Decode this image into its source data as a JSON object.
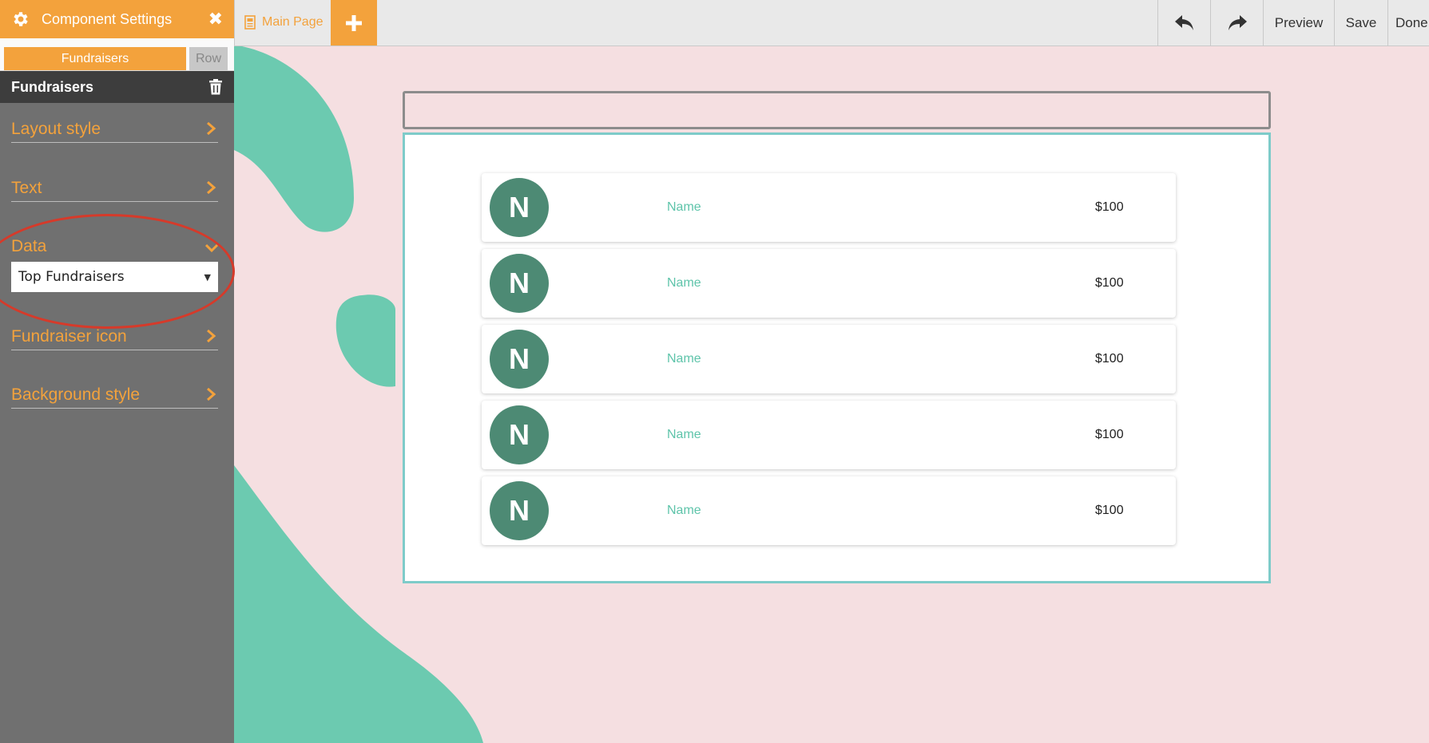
{
  "sidebar": {
    "header_title": "Component Settings",
    "tabs": [
      {
        "label": "Fundraisers",
        "active": true
      },
      {
        "label": "Row",
        "active": false
      }
    ],
    "section_title": "Fundraisers",
    "items": [
      {
        "label": "Layout style"
      },
      {
        "label": "Text"
      },
      {
        "label": "Data"
      },
      {
        "label": "Fundraiser icon"
      },
      {
        "label": "Background style"
      }
    ],
    "data_select_value": "Top Fundraisers"
  },
  "toolbar": {
    "page_tab": "Main Page",
    "preview": "Preview",
    "save": "Save",
    "done": "Done"
  },
  "fundraisers": [
    {
      "initial": "N",
      "name": "Name",
      "amount": "$100"
    },
    {
      "initial": "N",
      "name": "Name",
      "amount": "$100"
    },
    {
      "initial": "N",
      "name": "Name",
      "amount": "$100"
    },
    {
      "initial": "N",
      "name": "Name",
      "amount": "$100"
    },
    {
      "initial": "N",
      "name": "Name",
      "amount": "$100"
    }
  ],
  "colors": {
    "accent": "#f3a23c",
    "sidebar_bg": "#707070",
    "canvas_bg": "#f5dfe1",
    "blob": "#6ccab0",
    "avatar": "#4d8a74",
    "name_text": "#5ec4aa",
    "annotation": "#d63a2a"
  },
  "icons": [
    "gear-icon",
    "close-icon",
    "trash-icon",
    "chevron-right-icon",
    "chevron-down-icon",
    "document-icon",
    "plus-icon",
    "undo-icon",
    "redo-icon"
  ]
}
